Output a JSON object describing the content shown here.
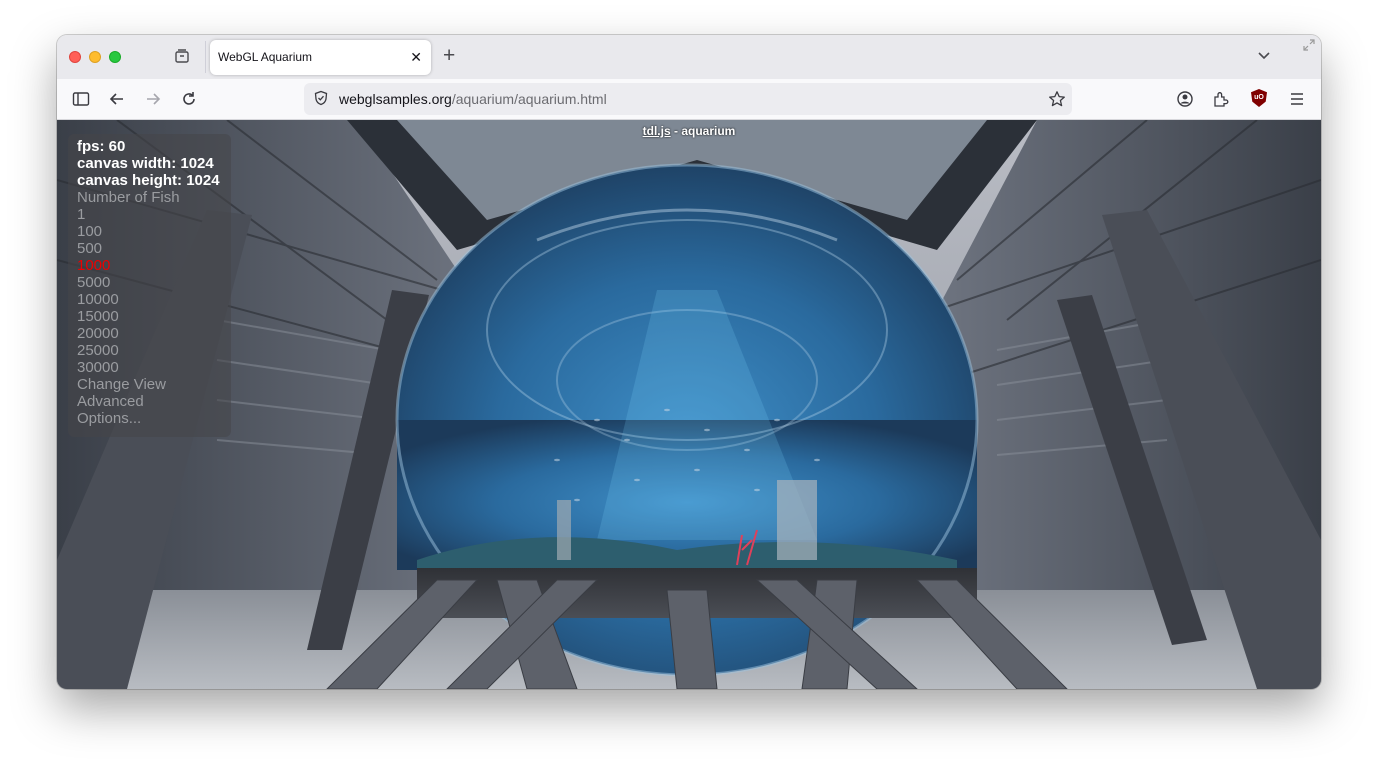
{
  "browser": {
    "tab_title": "WebGL Aquarium",
    "tab_close": "✕",
    "new_tab": "+",
    "url_domain": "webglsamples.org",
    "url_path": "/aquarium/aquarium.html"
  },
  "overlay": {
    "title_link": "tdl.js",
    "title_rest": " - aquarium"
  },
  "stats": {
    "fps": "fps: 60",
    "canvas_width": "canvas width: 1024",
    "canvas_height": "canvas height: 1024"
  },
  "menu": {
    "heading": "Number of Fish",
    "fish_options": [
      "1",
      "100",
      "500",
      "1000",
      "5000",
      "10000",
      "15000",
      "20000",
      "25000",
      "30000"
    ],
    "selected_index": 3,
    "change_view": "Change View",
    "advanced_1": "Advanced",
    "advanced_2": "Options..."
  },
  "colors": {
    "selected": "#ee0000",
    "option": "#9a9ca0",
    "ublock": "#800000"
  },
  "icons": [
    "sidebar-icon",
    "back-icon",
    "forward-icon",
    "reload-icon",
    "shield-icon",
    "star-icon",
    "account-icon",
    "extensions-icon",
    "ublock-icon",
    "menu-icon",
    "chevron-down-icon",
    "tab-overview-icon"
  ]
}
